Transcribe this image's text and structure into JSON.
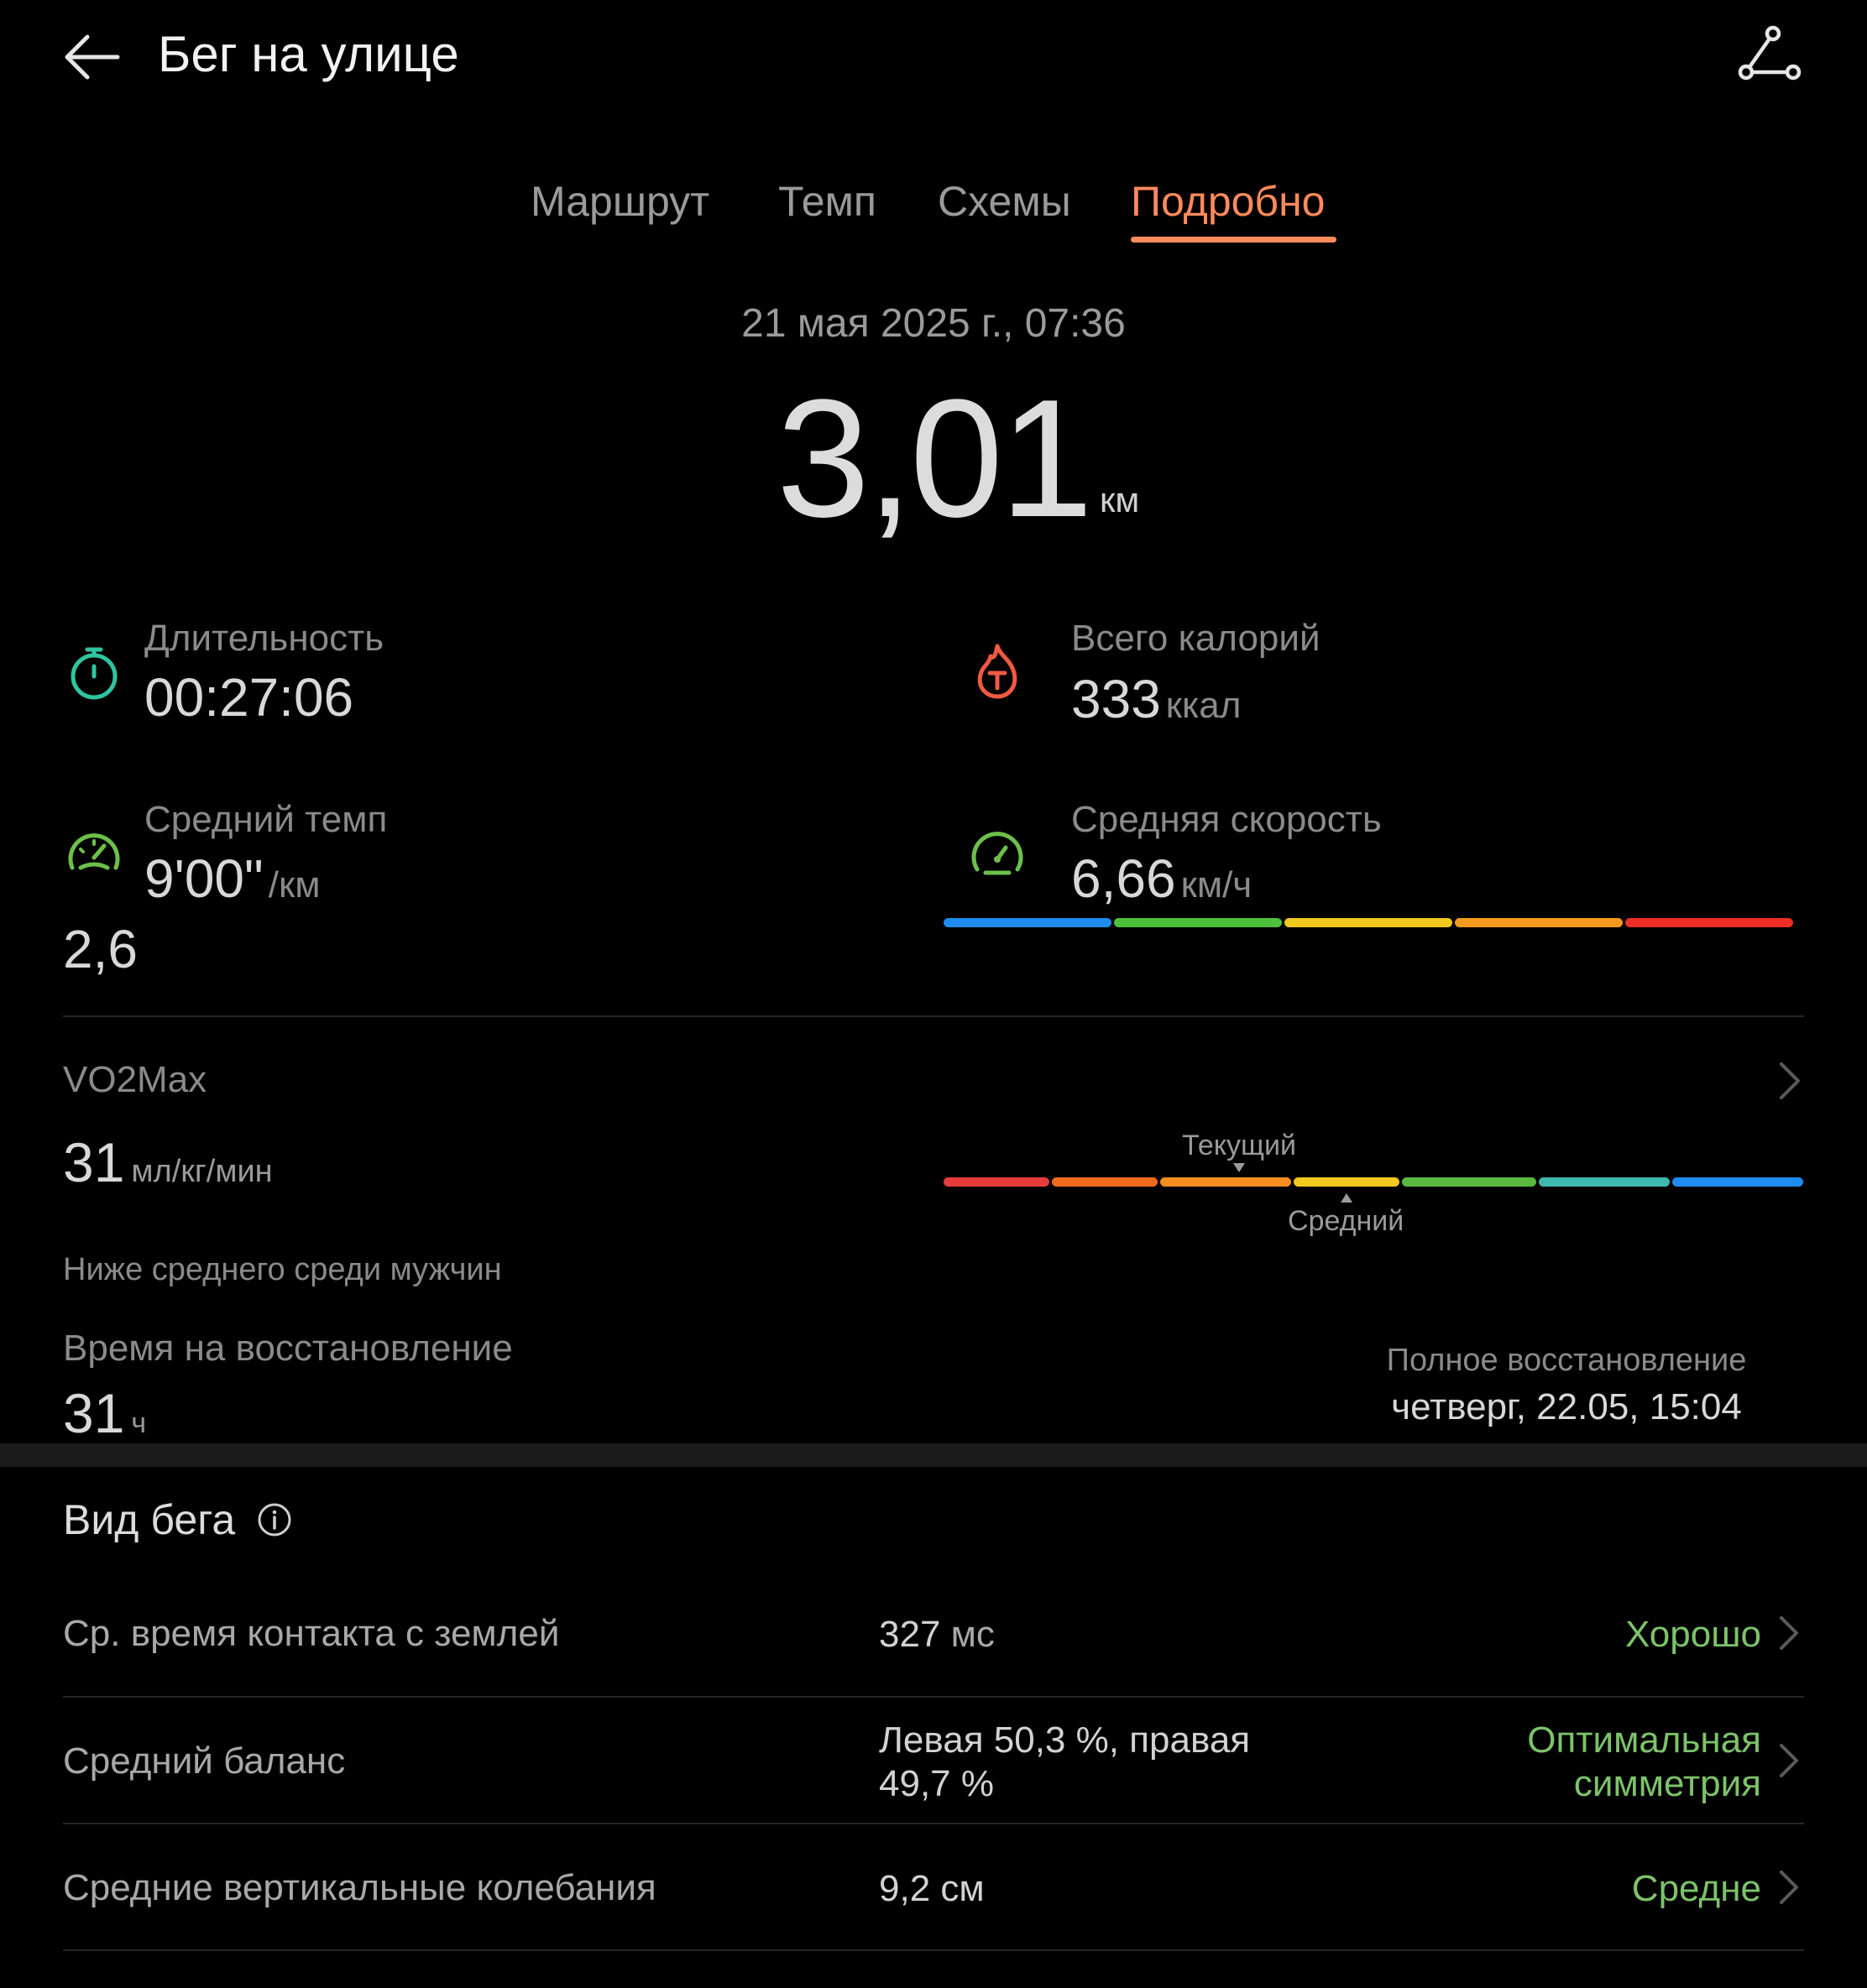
{
  "header": {
    "title": "Бег на улице",
    "back_icon": "back-arrow-icon",
    "route_icon": "route-share-icon"
  },
  "tabs": [
    {
      "label": "Маршрут"
    },
    {
      "label": "Темп"
    },
    {
      "label": "Схемы"
    },
    {
      "label": "Подробно",
      "active": true
    }
  ],
  "accent_color": "#ff8a5c",
  "summary": {
    "date": "21 мая 2025 г., 07:36",
    "distance": "3,01",
    "distance_unit": "км"
  },
  "stats": {
    "duration": {
      "label": "Длительность",
      "value": "00:27:06",
      "icon": "stopwatch-icon"
    },
    "calories": {
      "label": "Всего калорий",
      "value": "333",
      "unit": "ккал",
      "icon": "calories-flame-icon"
    },
    "avg_pace": {
      "label": "Средний темп",
      "value": "9'00\"",
      "unit": "/км",
      "extra": "2,6",
      "icon": "pace-gauge-icon"
    },
    "avg_speed": {
      "label": "Средняя скорость",
      "value": "6,66",
      "unit": "км/ч",
      "icon": "speed-gauge-icon"
    }
  },
  "vo2max": {
    "title": "VO2Max",
    "value": "31",
    "unit": "мл/кг/мин",
    "note": "Ниже среднего среди мужчин",
    "current_label": "Текущий",
    "average_label": "Средний"
  },
  "recovery": {
    "label": "Время на восстановление",
    "value": "31",
    "unit": "ч",
    "full_label": "Полное восстановление",
    "full_value": "четверг, 22.05, 15:04"
  },
  "running_form": {
    "title": "Вид бега",
    "rows": [
      {
        "label": "Ср. время контакта с землей",
        "value": "327",
        "unit": "мс",
        "status": "Хорошо"
      },
      {
        "label": "Средний баланс",
        "value_line1": "Левая 50,3 %, правая",
        "value_line2": "49,7 %",
        "status_line1": "Оптимальная",
        "status_line2": "симметрия"
      },
      {
        "label": "Средние вертикальные колебания",
        "value": "9,2 см",
        "status": "Средне"
      }
    ]
  },
  "status_color": "#7cc36a"
}
